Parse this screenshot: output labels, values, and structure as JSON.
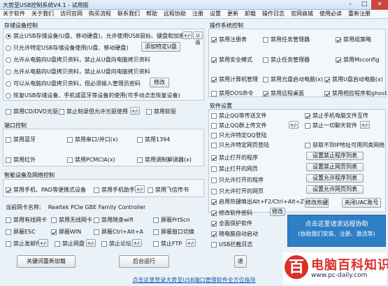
{
  "window": {
    "title": "大势至USB控制系统V4.1 - 试用版",
    "minimize": "–",
    "maximize": "□",
    "close": "×"
  },
  "menu": [
    "关于软件",
    "关于我们",
    "访问官网",
    "购买流程",
    "联系我们",
    "帮助",
    "远程协助",
    "注册",
    "设置",
    "更新",
    "卸载",
    "操作日志",
    "官网商城",
    "使用必读",
    "重新注册"
  ],
  "storage": {
    "title": "存储设备控制",
    "opt1": "禁止USB存储设备(U盘、移动硬盘)，允许使用USB鼠标、键盘和加密狗",
    "opt1_btn": "+/-",
    "opt1_btn2": "U盾",
    "opt2": "只允许特定USB存储设备使用(U盘、移动硬盘)",
    "opt2_btn": "添加特定U盘",
    "opt3": "允许从电脑向U盘拷贝资料，禁止从U盘向电脑拷贝资料",
    "opt4": "允许从电脑向U盘拷贝资料，禁止从U盘向电脑拷贝资料",
    "opt5": "可以从电脑向U盘拷贝资料，但必须输入管理员密码",
    "opt5_btn": "修改",
    "opt6": "恢复USB存储设备、手机或蓝牙等设备的使用(可手动点击恢复设备)",
    "cd": "禁用CD/DVD光驱",
    "burn": "禁止刻录但允许光驱使用",
    "burn_btn": "+/-",
    "floppy": "禁用软驱"
  },
  "port": {
    "title": "端口控制",
    "items": [
      "禁用蓝牙",
      "禁用串口/并口(x)",
      "禁用1394",
      "禁用红外",
      "禁用PCMCIA(x)",
      "禁用调制解调器(x)"
    ]
  },
  "smart": {
    "title": "智能设备及网络控制",
    "phone": "禁用手机、PAD等便携式设备",
    "helper": "禁用手机助手",
    "helper_btn": "+/-",
    "vm": "禁用飞信传书",
    "nic_label": "当前网卡名称:",
    "nic_name": "Realtek PCIe GBE Family Controller",
    "net": [
      "禁用有线网卡",
      "禁用无线网卡",
      "禁用随身wifi",
      "屏蔽PrtScn",
      "屏蔽ESC",
      "屏蔽WIN",
      "屏蔽Ctrl+Alt+A",
      "屏蔽窗口切换",
      "禁止发邮件",
      "禁止网盘",
      "禁止论坛",
      "禁止FTP"
    ],
    "net_btn": "+/-"
  },
  "os": {
    "title": "操作系统控制",
    "items": [
      "禁用注册表",
      "禁用任务管理器",
      "禁用组策略",
      "禁用安全模式",
      "禁止任务管理器",
      "禁用Msconfig",
      "禁用计算机管理",
      "禁用光盘启动电脑(x)",
      "禁用U盘启动电脑(x)",
      "禁用DOS命令",
      "禁用远程桌面",
      "禁止修改操作系统"
    ],
    "extra": "禁用相应程序和ghost"
  },
  "software": {
    "title": "软件设置",
    "items": [
      "禁止QQ等传送文件",
      "禁止QQ群上传文件",
      "只允许特定QQ登陆",
      "只允许特定网页登陆",
      "禁止打开的程序",
      "禁止打开的网页",
      "只允许打开的程序",
      "只允许打开的网页",
      "启用热键唤出Alt+F2/Ctrl+Alt+Z",
      "修改软件密码",
      "全面保护软件",
      "随电脑自动启动",
      "USB拦截日志"
    ],
    "right": [
      "禁止手机电脑文件互传",
      "禁止一切聊天软件",
      "获取不到IP地址可用同类网络"
    ],
    "btns": [
      "设置禁止程序列表",
      "设置禁止网页列表",
      "设置允许程序列表",
      "设置允许网页列表"
    ],
    "small": "+/-",
    "hotkey_btn": "修改热键",
    "uac_btn": "关闭UAC账号",
    "pwd_btn": "修改"
  },
  "bottom": {
    "all_clear": "关键词重新加载",
    "bg_run": "后台运行",
    "exit_hint": "退"
  },
  "promo": {
    "line1": "点击这里请求远程协助",
    "line2": "(协助我们安装、注册、激活等)"
  },
  "footer": "点击这里登录大势至USB端口管理软件全方位指导",
  "watermark": {
    "logo": "百",
    "t1": "电脑百科知识",
    "t2": "www.pc-daily.com"
  }
}
